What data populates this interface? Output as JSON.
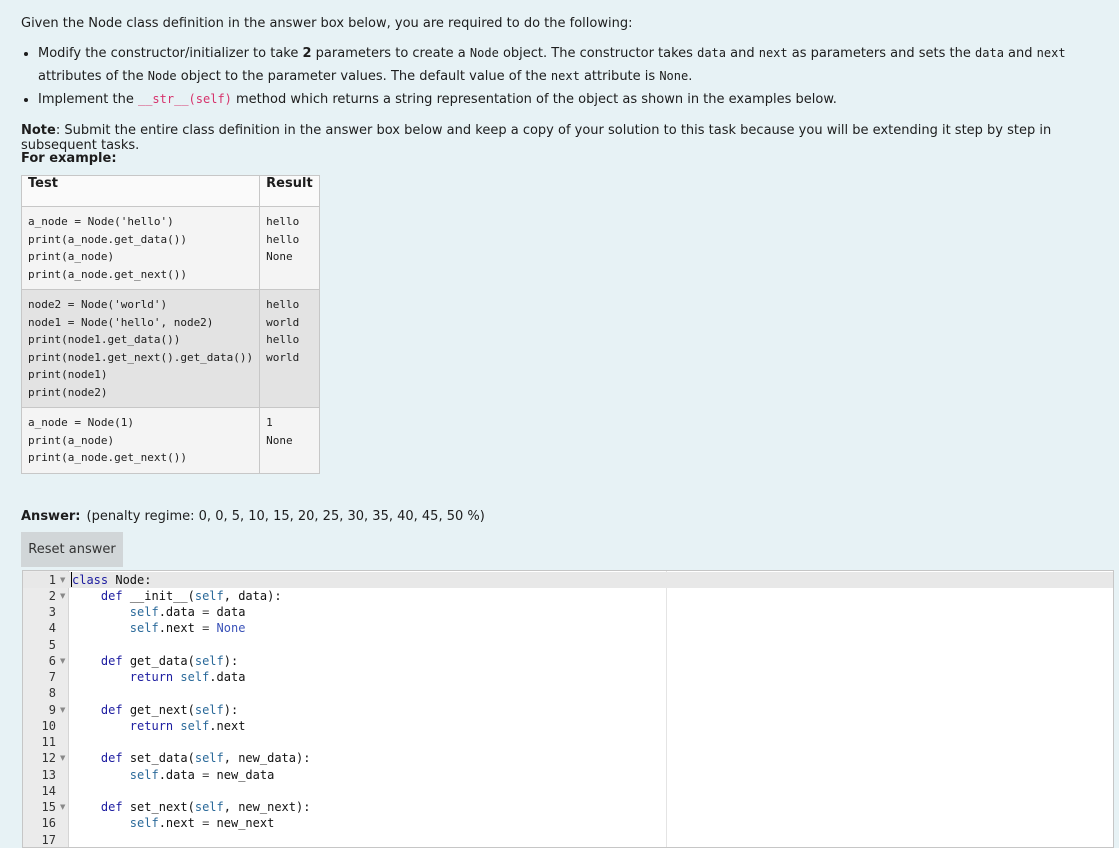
{
  "intro": "Given the Node class definition in the answer box below, you are required to do the following:",
  "bullet1": {
    "p1": "Modify the constructor/initializer to take ",
    "num": "2",
    "p2": " parameters to create a ",
    "c1": "Node",
    "p3": " object. The constructor takes ",
    "c2": "data",
    "p4": " and ",
    "c3": "next",
    "p5": " as parameters and sets the ",
    "c4": "data",
    "p6": " and ",
    "c5": "next",
    "p7": " attributes of the ",
    "c6": "Node",
    "p8": " object to the parameter values. The default value of the ",
    "c7": "next",
    "p9": " attribute is ",
    "c8": "None",
    "p10": "."
  },
  "bullet2": {
    "p1": "Implement the ",
    "c1": "__str__(self)",
    "p2": " method which returns a string representation of the object as shown in the examples below."
  },
  "note": {
    "label": "Note",
    "text": ": Submit the entire class definition in the answer box below and keep a copy of your solution to this task because you will be extending it step by step in subsequent tasks."
  },
  "for_example": "For example:",
  "table": {
    "headers": [
      "Test",
      "Result"
    ],
    "rows": [
      {
        "test": "a_node = Node('hello')\nprint(a_node.get_data())\nprint(a_node)\nprint(a_node.get_next())",
        "result": "hello\nhello\nNone"
      },
      {
        "test": "node2 = Node('world')\nnode1 = Node('hello', node2)\nprint(node1.get_data())\nprint(node1.get_next().get_data())\nprint(node1)\nprint(node2)",
        "result": "hello\nworld\nhello\nworld"
      },
      {
        "test": "a_node = Node(1)\nprint(a_node)\nprint(a_node.get_next())",
        "result": "1\nNone"
      }
    ]
  },
  "answer": {
    "label": "Answer:",
    "penalty": "(penalty regime: 0, 0, 5, 10, 15, 20, 25, 30, 35, 40, 45, 50 %)"
  },
  "reset_button": "Reset answer",
  "editor": {
    "lines": [
      {
        "n": "1",
        "fold": true,
        "text": "class Node:"
      },
      {
        "n": "2",
        "fold": true,
        "text": "    def __init__(self, data):"
      },
      {
        "n": "3",
        "fold": false,
        "text": "        self.data = data"
      },
      {
        "n": "4",
        "fold": false,
        "text": "        self.next = None"
      },
      {
        "n": "5",
        "fold": false,
        "text": ""
      },
      {
        "n": "6",
        "fold": true,
        "text": "    def get_data(self):"
      },
      {
        "n": "7",
        "fold": false,
        "text": "        return self.data"
      },
      {
        "n": "8",
        "fold": false,
        "text": ""
      },
      {
        "n": "9",
        "fold": true,
        "text": "    def get_next(self):"
      },
      {
        "n": "10",
        "fold": false,
        "text": "        return self.next"
      },
      {
        "n": "11",
        "fold": false,
        "text": ""
      },
      {
        "n": "12",
        "fold": true,
        "text": "    def set_data(self, new_data):"
      },
      {
        "n": "13",
        "fold": false,
        "text": "        self.data = new_data"
      },
      {
        "n": "14",
        "fold": false,
        "text": ""
      },
      {
        "n": "15",
        "fold": true,
        "text": "    def set_next(self, new_next):"
      },
      {
        "n": "16",
        "fold": false,
        "text": "        self.next = new_next"
      },
      {
        "n": "17",
        "fold": false,
        "text": ""
      }
    ]
  }
}
